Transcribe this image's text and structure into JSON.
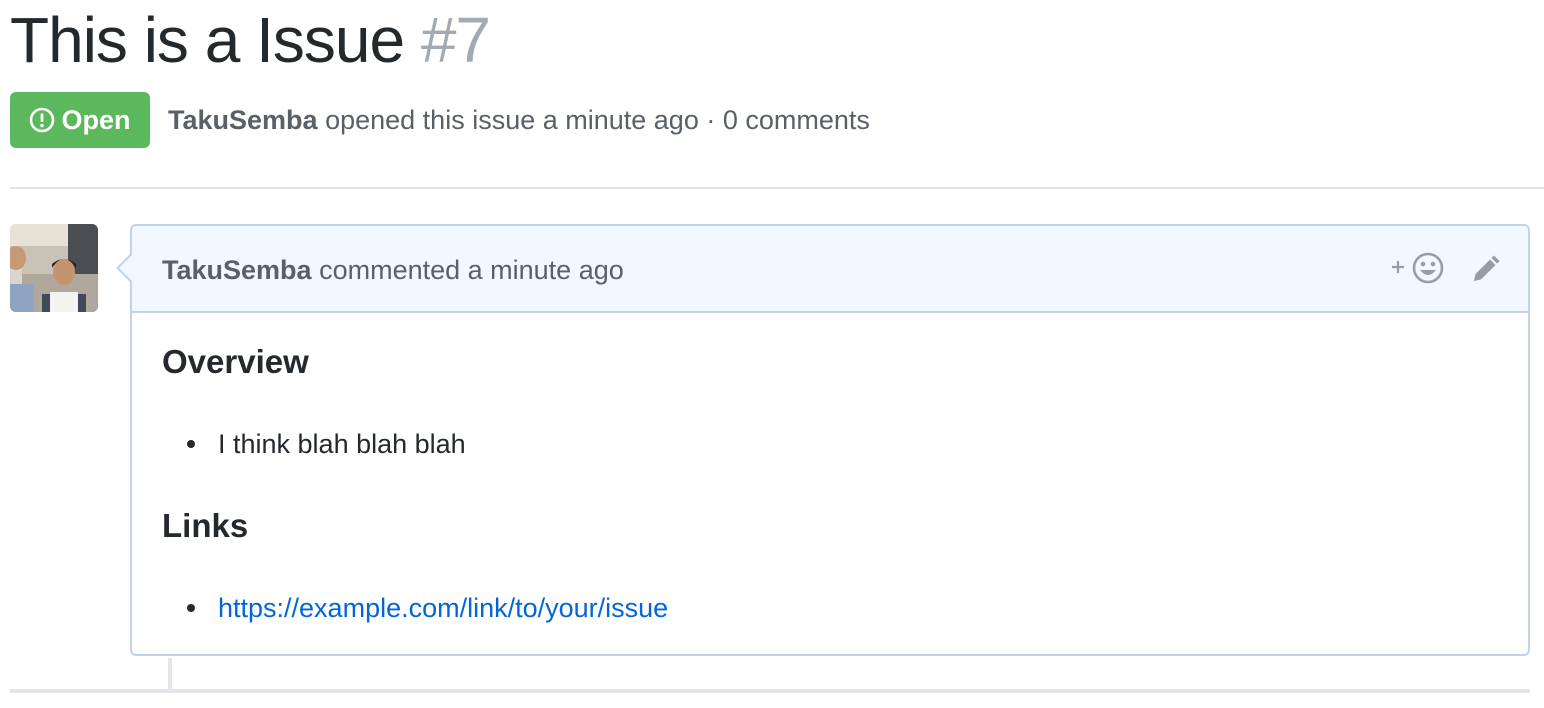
{
  "issue": {
    "title": "This is a Issue",
    "number": "#7",
    "state": "Open",
    "state_color": "#5cb85c",
    "state_icon": "issue-opened-icon",
    "author": "TakuSemba",
    "meta_text": "opened this issue a minute ago · 0 comments"
  },
  "comment": {
    "author": "TakuSemba",
    "action_text": "commented a minute ago",
    "header_icons": [
      "add-reaction-icon",
      "pencil-icon"
    ],
    "sections": [
      {
        "heading": "Overview",
        "items": [
          "I think blah blah blah"
        ]
      },
      {
        "heading": "Links",
        "items": [
          "https://example.com/link/to/your/issue"
        ]
      }
    ]
  },
  "colors": {
    "link": "#0366d6",
    "header_bg": "#f1f8ff",
    "border": "#c0d3eb",
    "muted": "#586069"
  }
}
